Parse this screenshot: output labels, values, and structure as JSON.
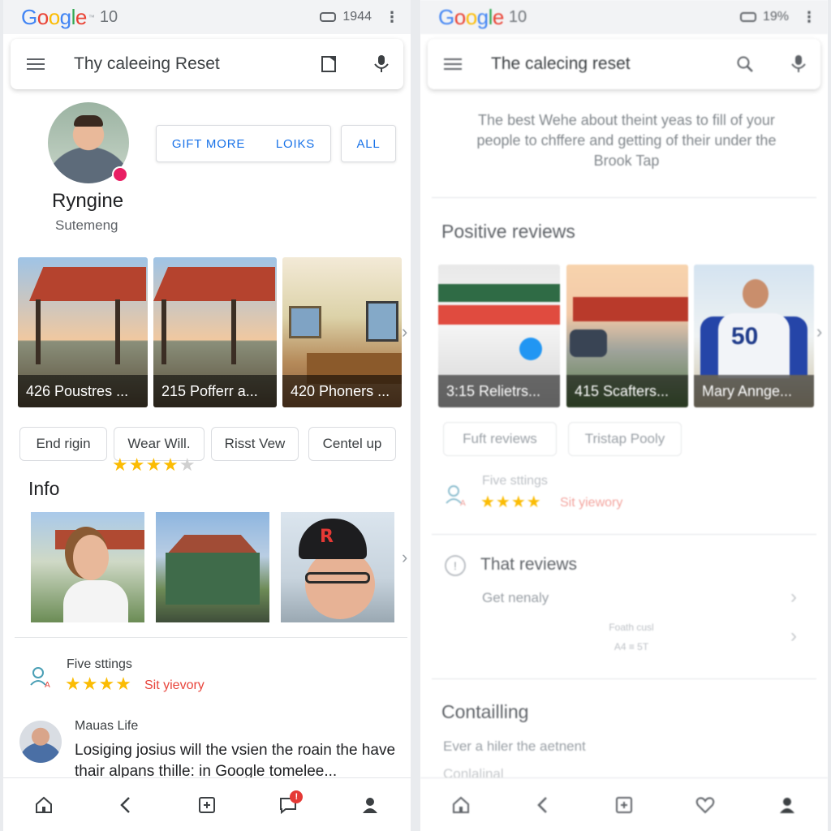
{
  "left": {
    "status": {
      "logo": "Google",
      "tm": "™",
      "num": "10",
      "time": "1944"
    },
    "search": {
      "title": "Thy caleeing Reset"
    },
    "profile": {
      "name": "Ryngine",
      "sub": "Sutemeng"
    },
    "buttons": {
      "gift_more": "GIFT MORE",
      "loiks": "LOIKS",
      "all": "ALL"
    },
    "cards": [
      {
        "caption": "426 Poustres ..."
      },
      {
        "caption": "215 Pofferr a..."
      },
      {
        "caption": "420 Phoners ..."
      }
    ],
    "chips": [
      "End rigin",
      "Wear Will.",
      "Risst Vew",
      "Centel up"
    ],
    "rating": {
      "stars": 4,
      "max": 5
    },
    "info": {
      "title": "Info"
    },
    "five_settings": {
      "label": "Five sttings",
      "stars": "★★★★",
      "link": "Sit yievory"
    },
    "review": {
      "name": "Mauas Life",
      "text": "Losiging josius will the vsien the roain the have thair alpans thille: in Google tomelee..."
    },
    "nav": {
      "notif": "!"
    }
  },
  "right": {
    "status": {
      "logo": "Google",
      "num": "10",
      "battery": "19%"
    },
    "search": {
      "title": "The calecing reset"
    },
    "description": "The best Wehe about theint yeas to fill of your people to chffere and getting of their under the Brook Tap",
    "positive": {
      "title": "Positive reviews"
    },
    "cards": [
      {
        "caption": "3:15 Relietrs..."
      },
      {
        "caption": "415 Scafters..."
      },
      {
        "caption": "Mary Annge..."
      }
    ],
    "card_number": "50",
    "chips": [
      "Fuft reviews",
      "Tristap Pooly"
    ],
    "five_settings": {
      "label": "Five sttings",
      "stars": "★★★★",
      "link": "Sit yiewory"
    },
    "that_reviews": {
      "title": "That reviews",
      "sub": "Get nenaly",
      "tiny1": "Foath cusl",
      "tiny2": "A4 ≡ 5T"
    },
    "containing": {
      "title": "Contailling",
      "sub": "Ever a hiler the aetnent",
      "sub2": "Conlalinal"
    }
  },
  "colors": {
    "accent": "#1a73e8",
    "star": "#fbbc04",
    "link": "#e8453c",
    "badge": "#e91e63"
  }
}
